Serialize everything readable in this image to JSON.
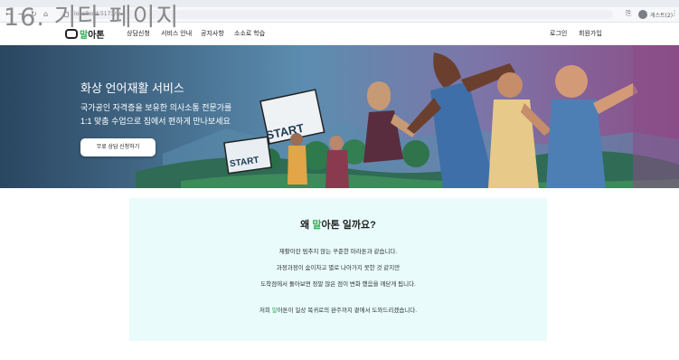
{
  "overlay_title": "16. 기타 페이지",
  "browser": {
    "back_glyph": "←",
    "forward_glyph": "→",
    "reload_glyph": "↻",
    "home_glyph": "⌂",
    "url": "localhost:5173/w",
    "profile_label": "게스트(2)",
    "menu_glyph": "⋮",
    "share_glyph": "⎘",
    "icons": [
      "back-arrow-icon",
      "forward-arrow-icon",
      "reload-icon",
      "home-icon",
      "lock-icon",
      "share-icon",
      "profile-icon",
      "kebab-menu-icon"
    ]
  },
  "header": {
    "logo_prefix": "말",
    "logo_suffix": "아톤",
    "nav": [
      "상담신청",
      "서비스 안내",
      "공지사항",
      "소소로 학습"
    ],
    "login": "로그인",
    "signup": "회원가입"
  },
  "hero": {
    "title": "화상 언어재활 서비스",
    "subtitle_line1": "국가공인 자격증을 보유한 의사소통 전문가를",
    "subtitle_line2": "1:1 맞춤 수업으로 집에서 편하게 만나보세요",
    "cta": "무료 상담 신청하기",
    "sign_text_1": "START",
    "sign_text_2": "START"
  },
  "why": {
    "title_prefix": "왜 ",
    "title_accent": "말",
    "title_suffix": "아톤 일까요?",
    "line1": "재활이란 멈추지 않는 꾸준한 마라톤과 같습니다.",
    "line2": "과정과정이 숨이차고 별로 나아가지 못한 것 같지만",
    "line3": "도착점에서 돌아보면 정말 많은 점이 변화 했음을 깨닫게 됩니다.",
    "line4_prefix": "저희 ",
    "line4_accent": "말",
    "line4_suffix": "아톤이 일상 복귀로의 완주까지 곁에서 도와드리겠습니다."
  },
  "colors": {
    "accent": "#3aaa55",
    "why_background": "#e9fbfb"
  }
}
